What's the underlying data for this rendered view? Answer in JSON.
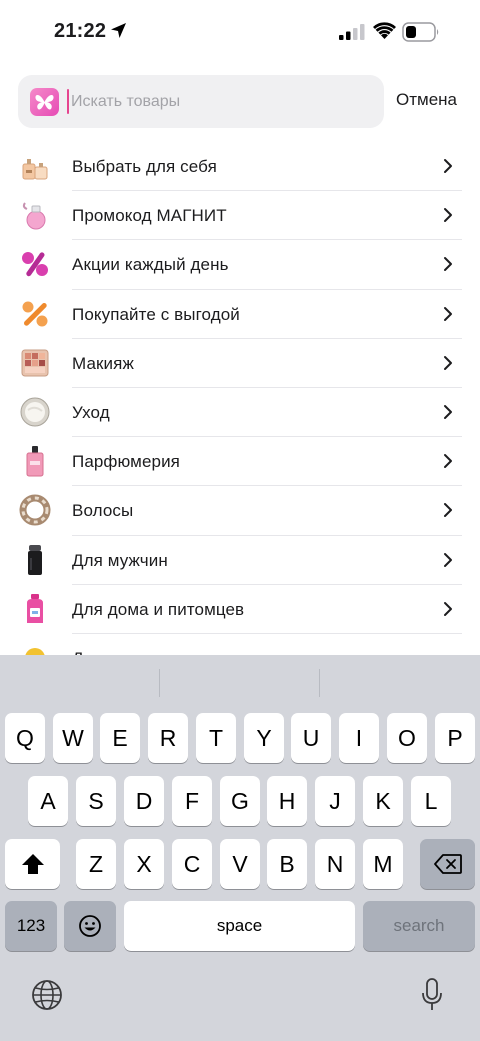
{
  "status_bar": {
    "time": "21:22"
  },
  "search": {
    "placeholder": "Искать товары",
    "value": "",
    "cancel_label": "Отмена"
  },
  "categories": [
    {
      "label": "Выбрать для себя",
      "icon": "perfume-set-icon"
    },
    {
      "label": "Промокод МАГНИТ",
      "icon": "pink-perfume-icon"
    },
    {
      "label": "Акции каждый день",
      "icon": "pink-percent-icon"
    },
    {
      "label": "Покупайте с выгодой",
      "icon": "orange-percent-icon"
    },
    {
      "label": "Макияж",
      "icon": "eyeshadow-palette-icon"
    },
    {
      "label": "Уход",
      "icon": "cream-jar-icon"
    },
    {
      "label": "Парфюмерия",
      "icon": "perfume-bottle-icon"
    },
    {
      "label": "Волосы",
      "icon": "scrunchie-icon"
    },
    {
      "label": "Для мужчин",
      "icon": "deodorant-icon"
    },
    {
      "label": "Для дома и питомцев",
      "icon": "detergent-bottle-icon"
    },
    {
      "label": "Д",
      "icon": "yellow-item-icon"
    }
  ],
  "keyboard": {
    "row1": [
      "Q",
      "W",
      "E",
      "R",
      "T",
      "Y",
      "U",
      "I",
      "O",
      "P"
    ],
    "row2": [
      "A",
      "S",
      "D",
      "F",
      "G",
      "H",
      "J",
      "K",
      "L"
    ],
    "row3": [
      "Z",
      "X",
      "C",
      "V",
      "B",
      "N",
      "M"
    ],
    "numbers_label": "123",
    "space_label": "space",
    "search_label": "search"
  },
  "colors": {
    "accent": "#e64bb5",
    "keyboard_bg": "#d3d5db",
    "key_bg": "#ffffff",
    "dark_key_bg": "#abb0ba"
  }
}
